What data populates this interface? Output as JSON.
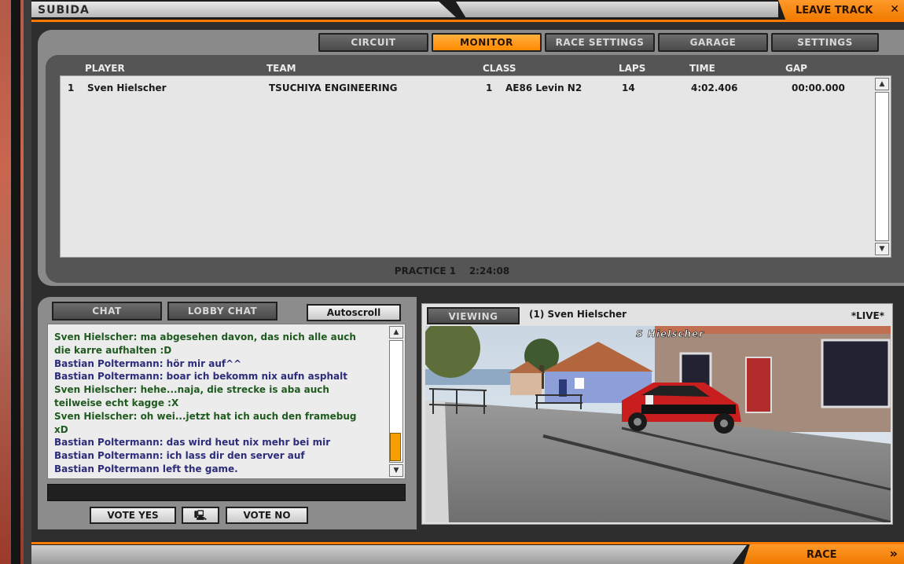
{
  "header": {
    "title": "SUBIDA",
    "leave_track_label": "LEAVE TRACK",
    "leave_icon_glyph": "✕"
  },
  "tabs": [
    {
      "label": "CIRCUIT",
      "active": false
    },
    {
      "label": "MONITOR",
      "active": true
    },
    {
      "label": "RACE SETTINGS",
      "active": false
    },
    {
      "label": "GARAGE",
      "active": false
    },
    {
      "label": "SETTINGS",
      "active": false
    }
  ],
  "standings": {
    "columns": [
      "PLAYER",
      "TEAM",
      "CLASS",
      "LAPS",
      "TIME",
      "GAP"
    ],
    "rows": [
      {
        "pos": "1",
        "player": "Sven Hielscher",
        "team": "TSUCHIYA ENGINEERING",
        "class_num": "1",
        "class_name": "AE86 Levin N2",
        "laps": "14",
        "time": "4:02.406",
        "gap": "00:00.000"
      }
    ]
  },
  "session": {
    "label": "PRACTICE 1",
    "time": "2:24:08"
  },
  "chat": {
    "tabs": [
      "CHAT",
      "LOBBY CHAT"
    ],
    "autoscroll_label": "Autoscroll",
    "messages": [
      {
        "text": "Sven Hielscher: ma abgesehen davon, das nich alle auch",
        "color": "green"
      },
      {
        "text": "die karre aufhalten :D",
        "color": "green"
      },
      {
        "text": "Bastian Poltermann: hör mir auf^^",
        "color": "blue"
      },
      {
        "text": "Bastian Poltermann: boar ich bekomm nix aufn asphalt",
        "color": "blue"
      },
      {
        "text": "Sven Hielscher: hehe...naja, die strecke is aba auch",
        "color": "green"
      },
      {
        "text": "teilweise echt kagge :X",
        "color": "green"
      },
      {
        "text": "Sven Hielscher: oh wei...jetzt hat ich auch den framebug",
        "color": "green"
      },
      {
        "text": "xD",
        "color": "green"
      },
      {
        "text": "Bastian Poltermann: das wird heut nix mehr bei mir",
        "color": "blue"
      },
      {
        "text": "Bastian Poltermann: ich lass dir den server auf",
        "color": "blue"
      },
      {
        "text": "Bastian Poltermann left the game.",
        "color": "blue"
      }
    ],
    "vote_yes_label": "VOTE YES",
    "vote_no_label": "VOTE NO",
    "vote_icon_glyph": "🖳"
  },
  "viewer": {
    "viewing_label": "VIEWING",
    "viewing_name": "(1) Sven Hielscher",
    "live_label": "*LIVE*",
    "overlay_name": "S Hielscher"
  },
  "bottom": {
    "race_label": "RACE",
    "race_icon_glyph": "»"
  },
  "colors": {
    "accent": "#ff8a00",
    "chat_green": "#1f5a1f",
    "chat_blue": "#2c2c7a"
  }
}
